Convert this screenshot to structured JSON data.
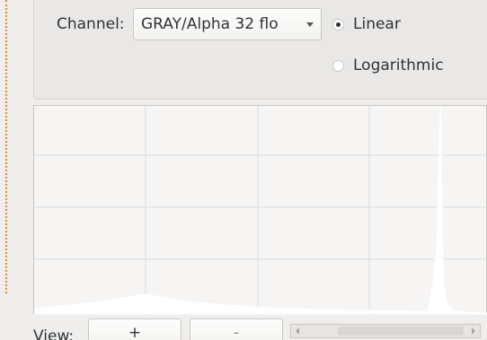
{
  "channel": {
    "label": "Channel:",
    "selected": "GRAY/Alpha 32 flo"
  },
  "scale": {
    "linear_label": "Linear",
    "logarithmic_label": "Logarithmic",
    "selected": "Linear"
  },
  "view": {
    "label": "View:",
    "zoom_in_label": "+",
    "zoom_out_label": "-"
  },
  "histogram": {
    "background": "#ffffff",
    "grid_color": "#dcdcdc"
  },
  "colors": {
    "accent": "#e08a1e",
    "text": "#2e3436"
  }
}
